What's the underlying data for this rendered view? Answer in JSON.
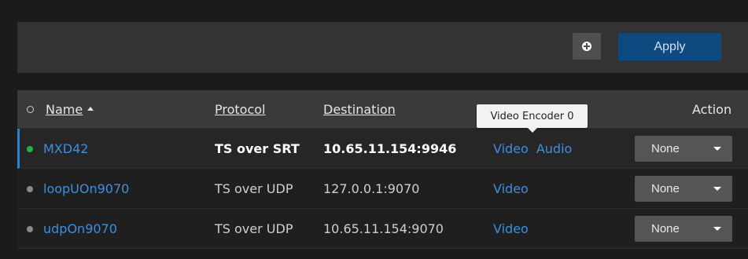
{
  "toolbar": {
    "add_icon": "plus-circle-icon",
    "apply_label": "Apply"
  },
  "table": {
    "headers": {
      "name": "Name",
      "protocol": "Protocol",
      "destination": "Destination",
      "action": "Action"
    },
    "rows": [
      {
        "status": "active",
        "status_color": "#22b14c",
        "name": "MXD42",
        "protocol": "TS over SRT",
        "destination": "10.65.11.154:9946",
        "streams": [
          "Video",
          "Audio"
        ],
        "action": "None"
      },
      {
        "status": "inactive",
        "status_color": "#8a8a8a",
        "name": "loopUOn9070",
        "protocol": "TS over UDP",
        "destination": "127.0.0.1:9070",
        "streams": [
          "Video"
        ],
        "action": "None"
      },
      {
        "status": "inactive",
        "status_color": "#8a8a8a",
        "name": "udpOn9070",
        "protocol": "TS over UDP",
        "destination": "10.65.11.154:9070",
        "streams": [
          "Video"
        ],
        "action": "None"
      }
    ]
  },
  "tooltip": {
    "text": "Video Encoder 0"
  },
  "colors": {
    "accent": "#3d8fe0",
    "apply": "#0e4a80",
    "selected_bar": "#2a82d6"
  }
}
